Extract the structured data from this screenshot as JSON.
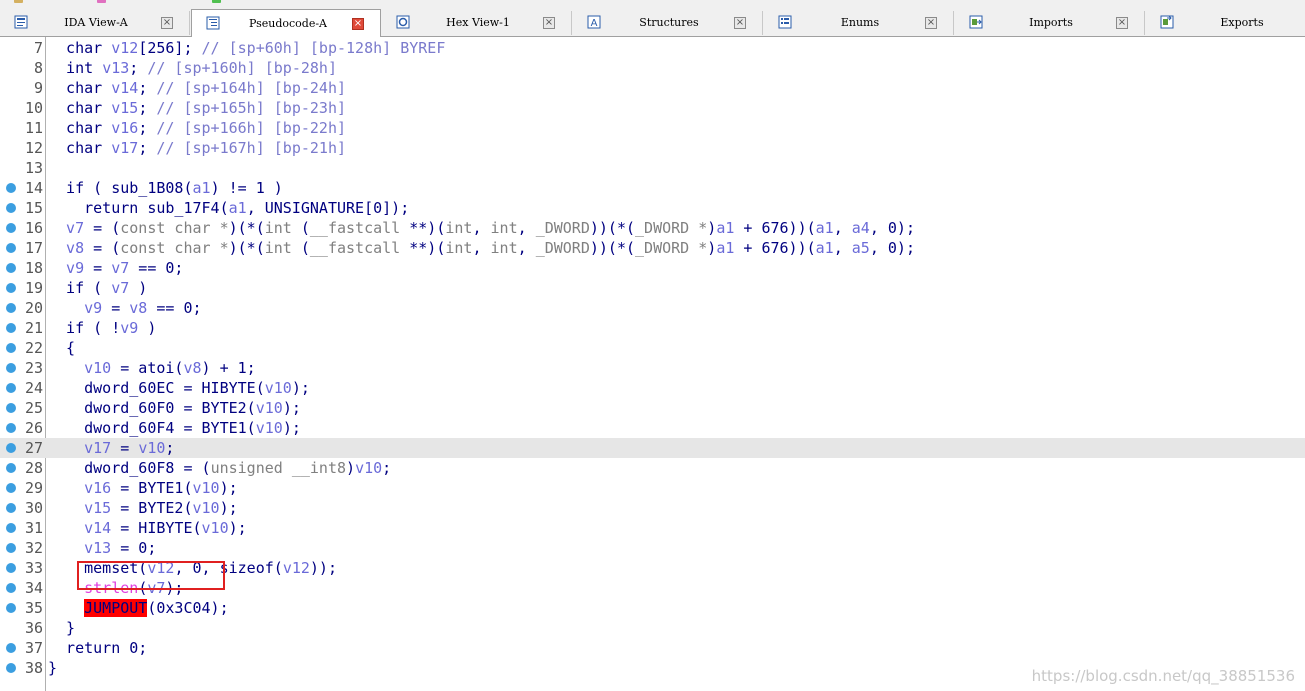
{
  "tabs": [
    {
      "label": "IDA View-A",
      "icon": "ida-view-icon",
      "active": false
    },
    {
      "label": "Pseudocode-A",
      "icon": "pseudocode-icon",
      "active": true
    },
    {
      "label": "Hex View-1",
      "icon": "hex-view-icon",
      "active": false
    },
    {
      "label": "Structures",
      "icon": "structures-icon",
      "active": false
    },
    {
      "label": "Enums",
      "icon": "enums-icon",
      "active": false
    },
    {
      "label": "Imports",
      "icon": "imports-icon",
      "active": false
    },
    {
      "label": "Exports",
      "icon": "exports-icon",
      "active": false
    }
  ],
  "close_glyph": "×",
  "colors": {
    "keyword": "#000080",
    "variable": "#6a6ad8",
    "comment": "#7a7acc",
    "breakpoint": "#3b9ee0",
    "error_highlight": "#ff0000",
    "active_tab_close": "#e04a3a",
    "box": "#e02020"
  },
  "code": {
    "lines": [
      {
        "num": "7",
        "bp": false,
        "segs": [
          [
            "c-blue",
            "  char "
          ],
          [
            "c-var",
            "v12"
          ],
          [
            "c-blue",
            "[256]; "
          ],
          [
            "c-comment",
            "// [sp+60h] [bp-128h] BYREF"
          ]
        ]
      },
      {
        "num": "8",
        "bp": false,
        "segs": [
          [
            "c-blue",
            "  int "
          ],
          [
            "c-var",
            "v13"
          ],
          [
            "c-blue",
            "; "
          ],
          [
            "c-comment",
            "// [sp+160h] [bp-28h]"
          ]
        ]
      },
      {
        "num": "9",
        "bp": false,
        "segs": [
          [
            "c-blue",
            "  char "
          ],
          [
            "c-var",
            "v14"
          ],
          [
            "c-blue",
            "; "
          ],
          [
            "c-comment",
            "// [sp+164h] [bp-24h]"
          ]
        ]
      },
      {
        "num": "10",
        "bp": false,
        "segs": [
          [
            "c-blue",
            "  char "
          ],
          [
            "c-var",
            "v15"
          ],
          [
            "c-blue",
            "; "
          ],
          [
            "c-comment",
            "// [sp+165h] [bp-23h]"
          ]
        ]
      },
      {
        "num": "11",
        "bp": false,
        "segs": [
          [
            "c-blue",
            "  char "
          ],
          [
            "c-var",
            "v16"
          ],
          [
            "c-blue",
            "; "
          ],
          [
            "c-comment",
            "// [sp+166h] [bp-22h]"
          ]
        ]
      },
      {
        "num": "12",
        "bp": false,
        "segs": [
          [
            "c-blue",
            "  char "
          ],
          [
            "c-var",
            "v17"
          ],
          [
            "c-blue",
            "; "
          ],
          [
            "c-comment",
            "// [sp+167h] [bp-21h]"
          ]
        ]
      },
      {
        "num": "13",
        "bp": false,
        "segs": []
      },
      {
        "num": "14",
        "bp": true,
        "segs": [
          [
            "c-blue",
            "  if ( sub_1B08("
          ],
          [
            "c-var",
            "a1"
          ],
          [
            "c-blue",
            ") != 1 )"
          ]
        ]
      },
      {
        "num": "15",
        "bp": true,
        "segs": [
          [
            "c-blue",
            "    return sub_17F4("
          ],
          [
            "c-var",
            "a1"
          ],
          [
            "c-blue",
            ", UNSIGNATURE[0]);"
          ]
        ]
      },
      {
        "num": "16",
        "bp": true,
        "segs": [
          [
            "c-var",
            "  v7"
          ],
          [
            "c-blue",
            " = ("
          ],
          [
            "c-gray",
            "const char *"
          ],
          [
            "c-blue",
            ")(*("
          ],
          [
            "c-gray",
            "int"
          ],
          [
            "c-blue",
            " ("
          ],
          [
            "c-gray",
            "__fastcall"
          ],
          [
            "c-blue",
            " **)("
          ],
          [
            "c-gray",
            "int"
          ],
          [
            "c-blue",
            ", "
          ],
          [
            "c-gray",
            "int"
          ],
          [
            "c-blue",
            ", "
          ],
          [
            "c-gray",
            "_DWORD"
          ],
          [
            "c-blue",
            "))(*("
          ],
          [
            "c-gray",
            "_DWORD *"
          ],
          [
            "c-blue",
            ")"
          ],
          [
            "c-var",
            "a1"
          ],
          [
            "c-blue",
            " + 676))("
          ],
          [
            "c-var",
            "a1"
          ],
          [
            "c-blue",
            ", "
          ],
          [
            "c-var",
            "a4"
          ],
          [
            "c-blue",
            ", 0);"
          ]
        ]
      },
      {
        "num": "17",
        "bp": true,
        "segs": [
          [
            "c-var",
            "  v8"
          ],
          [
            "c-blue",
            " = ("
          ],
          [
            "c-gray",
            "const char *"
          ],
          [
            "c-blue",
            ")(*("
          ],
          [
            "c-gray",
            "int"
          ],
          [
            "c-blue",
            " ("
          ],
          [
            "c-gray",
            "__fastcall"
          ],
          [
            "c-blue",
            " **)("
          ],
          [
            "c-gray",
            "int"
          ],
          [
            "c-blue",
            ", "
          ],
          [
            "c-gray",
            "int"
          ],
          [
            "c-blue",
            ", "
          ],
          [
            "c-gray",
            "_DWORD"
          ],
          [
            "c-blue",
            "))(*("
          ],
          [
            "c-gray",
            "_DWORD *"
          ],
          [
            "c-blue",
            ")"
          ],
          [
            "c-var",
            "a1"
          ],
          [
            "c-blue",
            " + 676))("
          ],
          [
            "c-var",
            "a1"
          ],
          [
            "c-blue",
            ", "
          ],
          [
            "c-var",
            "a5"
          ],
          [
            "c-blue",
            ", 0);"
          ]
        ]
      },
      {
        "num": "18",
        "bp": true,
        "segs": [
          [
            "c-var",
            "  v9"
          ],
          [
            "c-blue",
            " = "
          ],
          [
            "c-var",
            "v7"
          ],
          [
            "c-blue",
            " == 0;"
          ]
        ]
      },
      {
        "num": "19",
        "bp": true,
        "segs": [
          [
            "c-blue",
            "  if ( "
          ],
          [
            "c-var",
            "v7"
          ],
          [
            "c-blue",
            " )"
          ]
        ]
      },
      {
        "num": "20",
        "bp": true,
        "segs": [
          [
            "c-var",
            "    v9"
          ],
          [
            "c-blue",
            " = "
          ],
          [
            "c-var",
            "v8"
          ],
          [
            "c-blue",
            " == 0;"
          ]
        ]
      },
      {
        "num": "21",
        "bp": true,
        "segs": [
          [
            "c-blue",
            "  if ( !"
          ],
          [
            "c-var",
            "v9"
          ],
          [
            "c-blue",
            " )"
          ]
        ]
      },
      {
        "num": "22",
        "bp": true,
        "segs": [
          [
            "c-blue",
            "  {"
          ]
        ]
      },
      {
        "num": "23",
        "bp": true,
        "segs": [
          [
            "c-var",
            "    v10"
          ],
          [
            "c-blue",
            " = atoi("
          ],
          [
            "c-var",
            "v8"
          ],
          [
            "c-blue",
            ") + 1;"
          ]
        ]
      },
      {
        "num": "24",
        "bp": true,
        "segs": [
          [
            "c-blue",
            "    dword_60EC = HIBYTE("
          ],
          [
            "c-var",
            "v10"
          ],
          [
            "c-blue",
            ");"
          ]
        ]
      },
      {
        "num": "25",
        "bp": true,
        "segs": [
          [
            "c-blue",
            "    dword_60F0 = BYTE2("
          ],
          [
            "c-var",
            "v10"
          ],
          [
            "c-blue",
            ");"
          ]
        ]
      },
      {
        "num": "26",
        "bp": true,
        "segs": [
          [
            "c-blue",
            "    dword_60F4 = BYTE1("
          ],
          [
            "c-var",
            "v10"
          ],
          [
            "c-blue",
            ");"
          ]
        ]
      },
      {
        "num": "27",
        "bp": true,
        "hl": true,
        "segs": [
          [
            "c-var",
            "    v17"
          ],
          [
            "c-blue",
            " = "
          ],
          [
            "c-var",
            "v10"
          ],
          [
            "c-blue",
            ";"
          ]
        ]
      },
      {
        "num": "28",
        "bp": true,
        "segs": [
          [
            "c-blue",
            "    dword_60F8 = ("
          ],
          [
            "c-gray",
            "unsigned __int8"
          ],
          [
            "c-blue",
            ")"
          ],
          [
            "c-var",
            "v10"
          ],
          [
            "c-blue",
            ";"
          ]
        ]
      },
      {
        "num": "29",
        "bp": true,
        "segs": [
          [
            "c-var",
            "    v16"
          ],
          [
            "c-blue",
            " = BYTE1("
          ],
          [
            "c-var",
            "v10"
          ],
          [
            "c-blue",
            ");"
          ]
        ]
      },
      {
        "num": "30",
        "bp": true,
        "segs": [
          [
            "c-var",
            "    v15"
          ],
          [
            "c-blue",
            " = BYTE2("
          ],
          [
            "c-var",
            "v10"
          ],
          [
            "c-blue",
            ");"
          ]
        ]
      },
      {
        "num": "31",
        "bp": true,
        "segs": [
          [
            "c-var",
            "    v14"
          ],
          [
            "c-blue",
            " = HIBYTE("
          ],
          [
            "c-var",
            "v10"
          ],
          [
            "c-blue",
            ");"
          ]
        ]
      },
      {
        "num": "32",
        "bp": true,
        "segs": [
          [
            "c-var",
            "    v13"
          ],
          [
            "c-blue",
            " = 0;"
          ]
        ]
      },
      {
        "num": "33",
        "bp": true,
        "segs": [
          [
            "c-blue",
            "    memset("
          ],
          [
            "c-var",
            "v12"
          ],
          [
            "c-blue",
            ", 0, sizeof("
          ],
          [
            "c-var",
            "v12"
          ],
          [
            "c-blue",
            "));"
          ]
        ]
      },
      {
        "num": "34",
        "bp": true,
        "segs": [
          [
            "c-blue",
            "    "
          ],
          [
            "c-pink",
            "strlen"
          ],
          [
            "c-blue",
            "("
          ],
          [
            "c-var",
            "v7"
          ],
          [
            "c-blue",
            ");"
          ]
        ]
      },
      {
        "num": "35",
        "bp": true,
        "segs": [
          [
            "c-blue",
            "    "
          ],
          [
            "c-err",
            "JUMPOUT"
          ],
          [
            "c-blue",
            "(0x3C04);"
          ]
        ]
      },
      {
        "num": "36",
        "bp": false,
        "segs": [
          [
            "c-blue",
            "  }"
          ]
        ]
      },
      {
        "num": "37",
        "bp": true,
        "segs": [
          [
            "c-blue",
            "  return 0;"
          ]
        ]
      },
      {
        "num": "38",
        "bp": true,
        "segs": [
          [
            "c-blue",
            "}"
          ]
        ]
      }
    ]
  },
  "watermark": "https://blog.csdn.net/qq_38851536"
}
